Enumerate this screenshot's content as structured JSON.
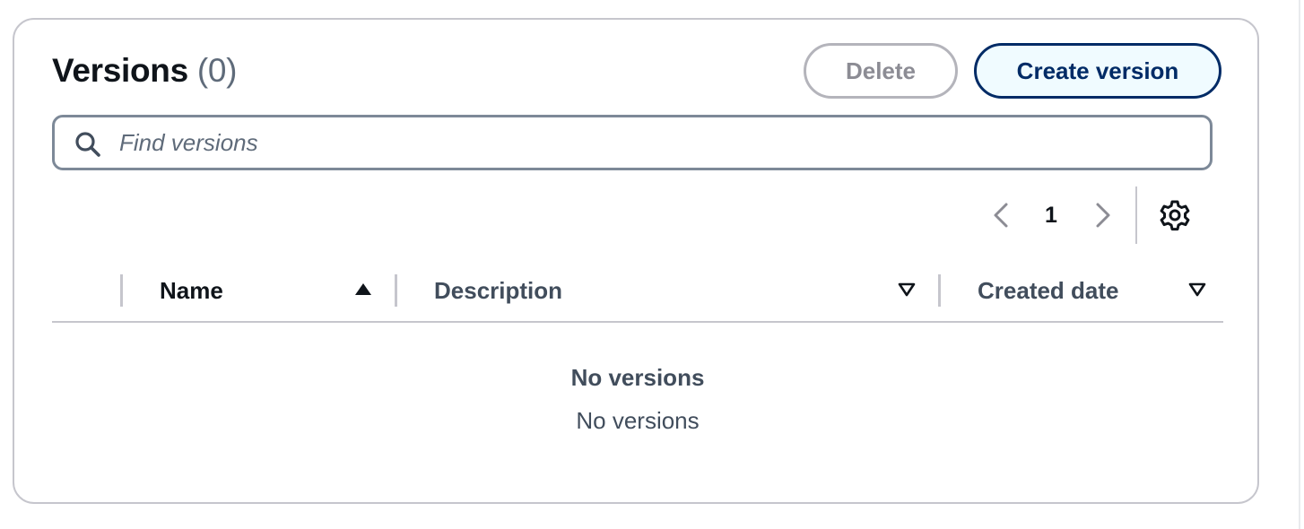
{
  "header": {
    "title": "Versions",
    "count": "(0)"
  },
  "actions": {
    "delete_label": "Delete",
    "delete_disabled": true,
    "create_label": "Create version"
  },
  "search": {
    "placeholder": "Find versions",
    "value": "",
    "icon": "search-icon"
  },
  "pagination": {
    "current_page": "1",
    "prev_icon": "chevron-left-icon",
    "next_icon": "chevron-right-icon",
    "settings_icon": "gear-icon"
  },
  "table": {
    "columns": [
      {
        "label": "Name",
        "sort": "ascending"
      },
      {
        "label": "Description",
        "sort": "none"
      },
      {
        "label": "Created date",
        "sort": "none"
      }
    ],
    "rows": [],
    "empty_title": "No versions",
    "empty_message": "No versions"
  },
  "colors": {
    "primary": "#002b66",
    "primary_bg": "#f0fbff",
    "border": "#c6c6cd",
    "text": "#0f141a",
    "muted": "#5f6b7a"
  }
}
